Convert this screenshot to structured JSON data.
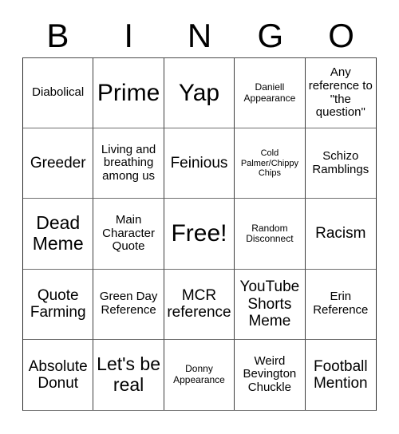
{
  "header": {
    "letters": [
      "B",
      "I",
      "N",
      "G",
      "O"
    ]
  },
  "grid": {
    "rows": [
      [
        {
          "label": "Diabolical",
          "size": "t-sm"
        },
        {
          "label": "Prime",
          "size": "t-xl"
        },
        {
          "label": "Yap",
          "size": "t-xl"
        },
        {
          "label": "Daniell Appearance",
          "size": "t-xs"
        },
        {
          "label": "Any reference to \"the question\"",
          "size": "t-sm"
        }
      ],
      [
        {
          "label": "Greeder",
          "size": "t-md"
        },
        {
          "label": "Living and breathing among us",
          "size": "t-sm"
        },
        {
          "label": "Feinious",
          "size": "t-md"
        },
        {
          "label": "Cold Palmer/Chippy Chips",
          "size": "t-xxs"
        },
        {
          "label": "Schizo Ramblings",
          "size": "t-sm"
        }
      ],
      [
        {
          "label": "Dead Meme",
          "size": "t-lg"
        },
        {
          "label": "Main Character Quote",
          "size": "t-sm"
        },
        {
          "label": "Free!",
          "size": "t-xl"
        },
        {
          "label": "Random Disconnect",
          "size": "t-xs"
        },
        {
          "label": "Racism",
          "size": "t-md"
        }
      ],
      [
        {
          "label": "Quote Farming",
          "size": "t-md"
        },
        {
          "label": "Green Day Reference",
          "size": "t-sm"
        },
        {
          "label": "MCR reference",
          "size": "t-md"
        },
        {
          "label": "YouTube Shorts Meme",
          "size": "t-md"
        },
        {
          "label": "Erin Reference",
          "size": "t-sm"
        }
      ],
      [
        {
          "label": "Absolute Donut",
          "size": "t-md"
        },
        {
          "label": "Let's be real",
          "size": "t-lg"
        },
        {
          "label": "Donny Appearance",
          "size": "t-xs"
        },
        {
          "label": "Weird Bevington Chuckle",
          "size": "t-sm"
        },
        {
          "label": "Football Mention",
          "size": "t-md"
        }
      ]
    ]
  },
  "colors": {
    "background": "#ffffff",
    "text": "#000000",
    "grid_line": "#3d3d3d"
  }
}
